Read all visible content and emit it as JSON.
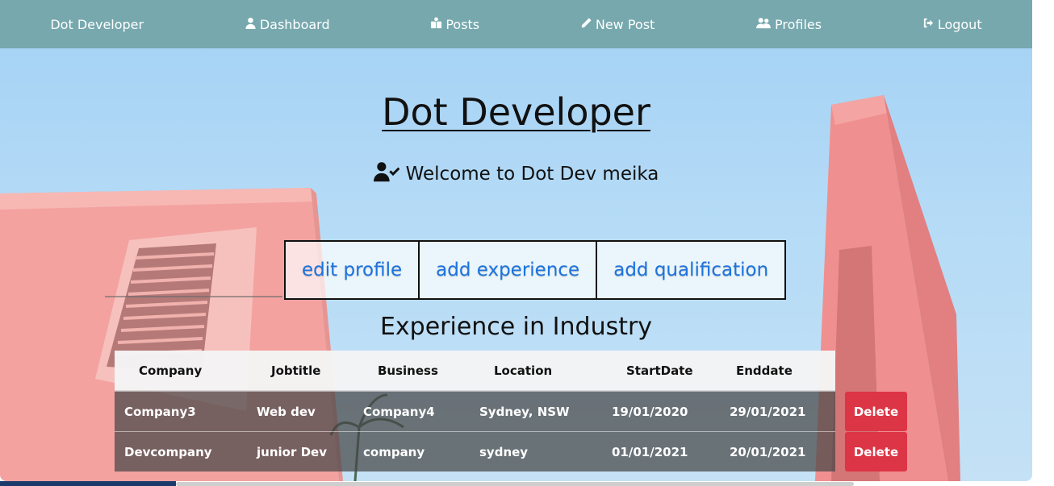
{
  "navbar": {
    "brand": "Dot Developer",
    "items": [
      {
        "label": "Dashboard",
        "icon": "user-icon"
      },
      {
        "label": "Posts",
        "icon": "posts-icon"
      },
      {
        "label": "New Post",
        "icon": "pencil-icon"
      },
      {
        "label": "Profiles",
        "icon": "users-icon"
      },
      {
        "label": "Logout",
        "icon": "logout-icon"
      }
    ]
  },
  "hero": {
    "title": "Dot Developer",
    "welcome": "Welcome to Dot Dev meika",
    "welcome_icon": "user-check-icon"
  },
  "actions": {
    "edit_profile": "edit profile",
    "add_experience": "add experience",
    "add_qualification": "add qualification"
  },
  "experience": {
    "title": "Experience in Industry",
    "columns": [
      "Company",
      "Jobtitle",
      "Business",
      "Location",
      "StartDate",
      "Enddate"
    ],
    "rows": [
      {
        "company": "Company3",
        "jobtitle": "Web dev",
        "business": "Company4",
        "location": "Sydney, NSW",
        "start": "19/01/2020",
        "end": "29/01/2021",
        "delete": "Delete"
      },
      {
        "company": "Devcompany",
        "jobtitle": "junior Dev",
        "business": "company",
        "location": "sydney",
        "start": "01/01/2021",
        "end": "20/01/2021",
        "delete": "Delete"
      }
    ]
  },
  "colors": {
    "navbar": "#76a8ae",
    "link": "#1c74e0",
    "delete": "#dc3545"
  }
}
